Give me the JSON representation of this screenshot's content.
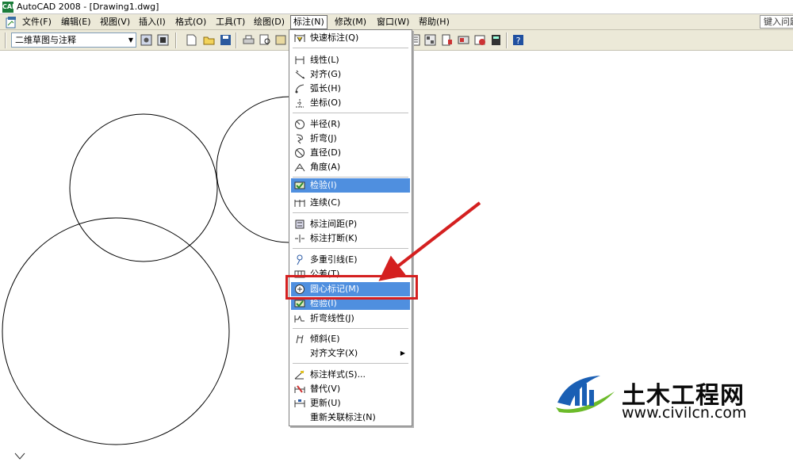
{
  "window": {
    "title": "AutoCAD 2008 - [Drawing1.dwg]",
    "app_icon_text": "CAD"
  },
  "menubar": {
    "items": [
      "文件(F)",
      "编辑(E)",
      "视图(V)",
      "插入(I)",
      "格式(O)",
      "工具(T)",
      "绘图(D)",
      "标注(N)",
      "修改(M)",
      "窗口(W)",
      "帮助(H)"
    ],
    "active": "标注(N)",
    "help_placeholder": "键入问题"
  },
  "toolbar": {
    "workspace": "二维草图与注释"
  },
  "dimension_menu": {
    "items": [
      {
        "label": "快速标注(Q)",
        "icon": "quick-dimension-icon"
      },
      {
        "label": "线性(L)",
        "icon": "linear-icon"
      },
      {
        "label": "对齐(G)",
        "icon": "aligned-icon"
      },
      {
        "label": "弧长(H)",
        "icon": "arc-length-icon"
      },
      {
        "label": "坐标(O)",
        "icon": "ordinate-icon"
      },
      {
        "label": "半径(R)",
        "icon": "radius-icon"
      },
      {
        "label": "折弯(J)",
        "icon": "jogged-icon"
      },
      {
        "label": "直径(D)",
        "icon": "diameter-icon"
      },
      {
        "label": "角度(A)",
        "icon": "angular-icon"
      },
      {
        "label": "检验(I)",
        "icon": "inspect-icon"
      },
      {
        "label": "连续(C)",
        "icon": "continue-icon"
      },
      {
        "label": "标注间距(P)",
        "icon": "dimension-space-icon"
      },
      {
        "label": "标注打断(K)",
        "icon": "dimension-break-icon"
      },
      {
        "label": "多重引线(E)",
        "icon": "multileader-icon"
      },
      {
        "label": "公差(T)",
        "icon": "tolerance-icon"
      },
      {
        "label": "圆心标记(M)",
        "icon": "center-mark-icon"
      },
      {
        "label": "检验(I)",
        "icon": "inspect-icon"
      },
      {
        "label": "折弯线性(J)",
        "icon": "jogged-linear-icon"
      },
      {
        "label": "倾斜(E)",
        "icon": "oblique-icon"
      },
      {
        "label": "对齐文字(X)",
        "icon": ""
      },
      {
        "label": "标注样式(S)...",
        "icon": "dimension-style-icon"
      },
      {
        "label": "替代(V)",
        "icon": "override-icon"
      },
      {
        "label": "更新(U)",
        "icon": "update-icon"
      },
      {
        "label": "重新关联标注(N)",
        "icon": ""
      }
    ],
    "highlighted": [
      "检验(I)",
      "圆心标记(M)"
    ]
  },
  "watermark": {
    "brand": "土木工程网",
    "url": "www.civilcn.com"
  },
  "colors": {
    "menu_highlight": "#4f8fdf",
    "annotation_red": "#d42020",
    "menubar_bg": "#ece9d8",
    "brand_blue": "#1a5fb4",
    "brand_green": "#6cbb2a"
  }
}
